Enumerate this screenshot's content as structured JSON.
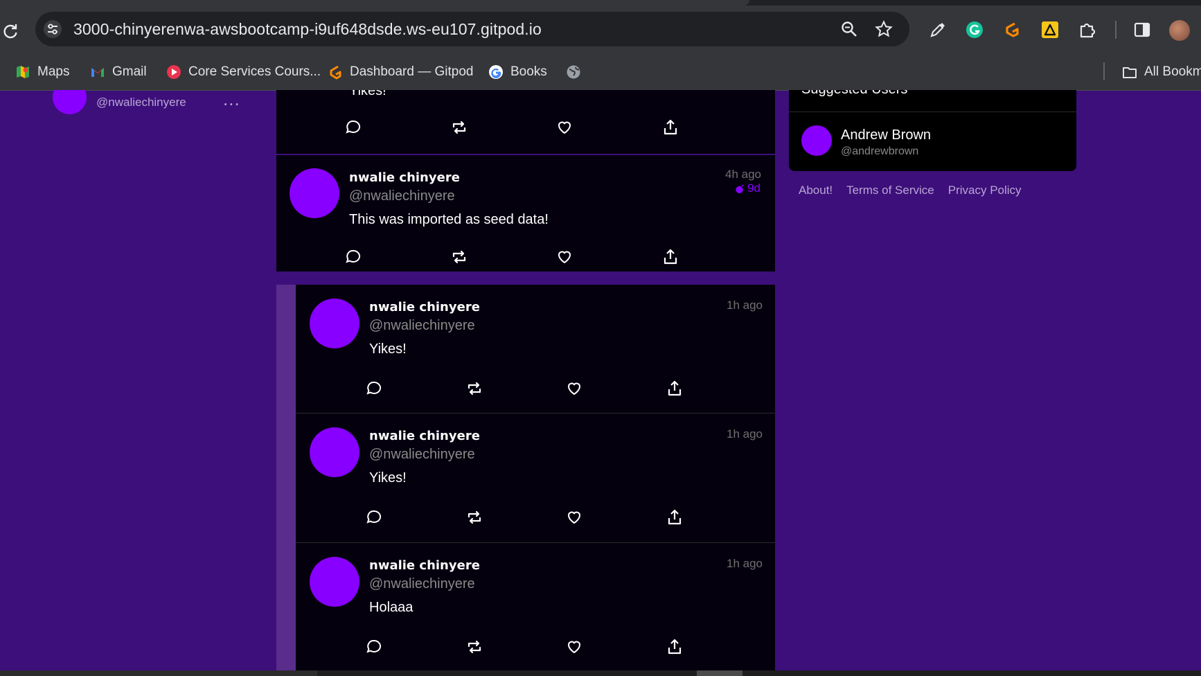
{
  "browser": {
    "url": "3000-chinyerenwa-awsbootcamp-i9uf648dsde.ws-eu107.gitpod.io",
    "bookmarks": [
      {
        "label": "Maps",
        "icon": "maps-icon"
      },
      {
        "label": "Gmail",
        "icon": "gmail-icon"
      },
      {
        "label": "Core Services Cours...",
        "icon": "play-icon"
      },
      {
        "label": "Dashboard — Gitpod",
        "icon": "gitpod-icon"
      },
      {
        "label": "Books",
        "icon": "google-icon"
      },
      {
        "label": "",
        "icon": "globe-icon"
      }
    ],
    "all_bookmarks": "All Bookm"
  },
  "sidebar": {
    "handle": "@nwaliechinyere",
    "more": "..."
  },
  "feed": {
    "top_partial": {
      "message": "Yikes!"
    },
    "activities": [
      {
        "name": "nwalie chinyere",
        "handle": "@nwaliechinyere",
        "message": "This was imported as seed data!",
        "time": "4h ago",
        "expires": "9d"
      }
    ],
    "replies": [
      {
        "name": "nwalie chinyere",
        "handle": "@nwaliechinyere",
        "message": "Yikes!",
        "time": "1h ago"
      },
      {
        "name": "nwalie chinyere",
        "handle": "@nwaliechinyere",
        "message": "Yikes!",
        "time": "1h ago"
      },
      {
        "name": "nwalie chinyere",
        "handle": "@nwaliechinyere",
        "message": "Holaaa",
        "time": "1h ago"
      }
    ]
  },
  "suggested": {
    "title": "Suggested Users",
    "users": [
      {
        "name": "Andrew Brown",
        "handle": "@andrewbrown"
      }
    ]
  },
  "footer_links": [
    "About!",
    "Terms of Service",
    "Privacy Policy"
  ],
  "colors": {
    "background": "#3d0f7a",
    "accent": "#8800ff",
    "card": "#05000e"
  }
}
